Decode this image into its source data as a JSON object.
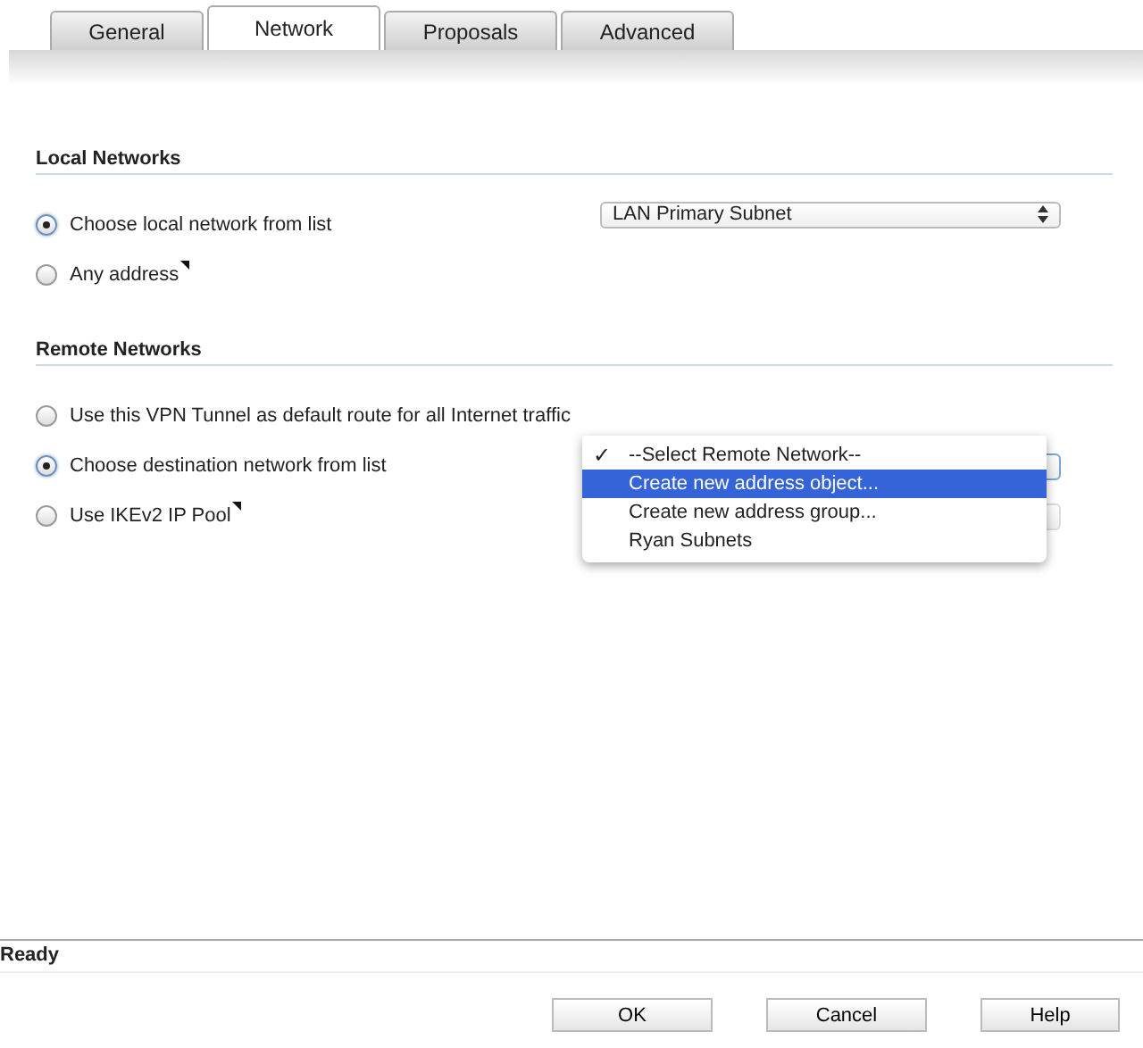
{
  "tabs": [
    {
      "label": "General",
      "selected": false
    },
    {
      "label": "Network",
      "selected": true
    },
    {
      "label": "Proposals",
      "selected": false
    },
    {
      "label": "Advanced",
      "selected": false
    }
  ],
  "local_networks": {
    "heading": "Local Networks",
    "options": [
      {
        "label": "Choose local network from list",
        "selected": true,
        "tooltip": false,
        "select_value": "LAN Primary Subnet"
      },
      {
        "label": "Any address",
        "selected": false,
        "tooltip": true
      }
    ]
  },
  "remote_networks": {
    "heading": "Remote Networks",
    "options": [
      {
        "label": "Use this VPN Tunnel as default route for all Internet traffic",
        "selected": false,
        "tooltip": false
      },
      {
        "label": "Choose destination network from list",
        "selected": true,
        "tooltip": false,
        "has_select": true
      },
      {
        "label": "Use IKEv2 IP Pool",
        "selected": false,
        "tooltip": true,
        "has_select": true
      }
    ],
    "dropdown": {
      "items": [
        {
          "check_mark": "✓",
          "label": "--Select Remote Network--",
          "selected": false
        },
        {
          "label": "Create new address object...",
          "selected": true
        },
        {
          "label": "Create new address group...",
          "selected": false
        },
        {
          "label": "Ryan Subnets",
          "selected": false
        }
      ]
    }
  },
  "status_bar": "Ready",
  "buttons": [
    "OK",
    "Cancel",
    "Help"
  ]
}
